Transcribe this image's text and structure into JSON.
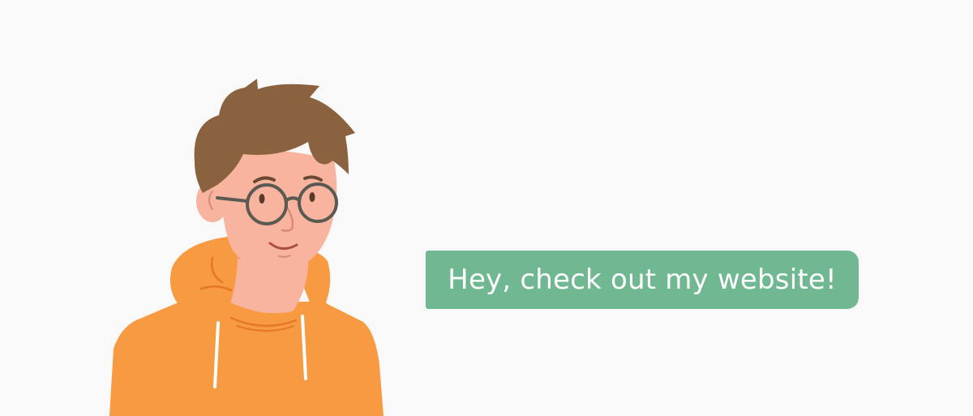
{
  "scene": {
    "background_color": "#f9f9f9"
  },
  "character": {
    "hair_color": "#8b6240",
    "skin_color": "#f8b49f",
    "hoodie_color": "#f79a42",
    "glasses_color": "#5a5a52"
  },
  "speech_bubble": {
    "text": "Hey, check out my website!",
    "background_color": "#6fb891",
    "text_color": "#ffffff"
  }
}
